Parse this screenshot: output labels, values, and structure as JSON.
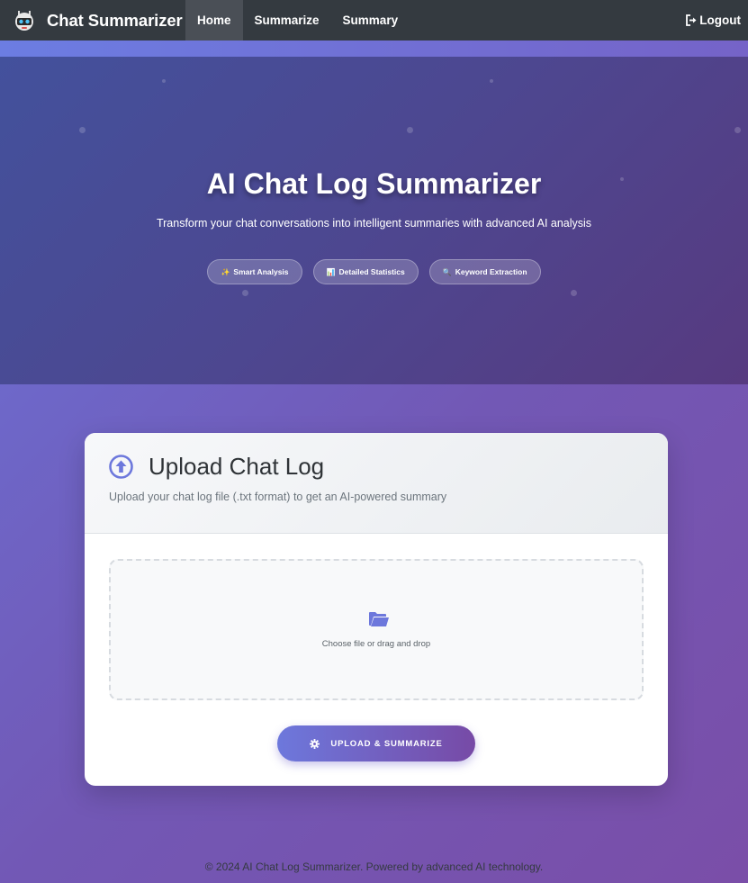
{
  "navbar": {
    "brand": "Chat Summarizer",
    "logo_icon": "robot-icon",
    "links": [
      {
        "label": "Home",
        "active": true
      },
      {
        "label": "Summarize",
        "active": false
      },
      {
        "label": "Summary",
        "active": false
      }
    ],
    "logout_label": "Logout",
    "logout_icon": "sign-out-icon"
  },
  "hero": {
    "title": "AI Chat Log Summarizer",
    "subtitle": "Transform your chat conversations into intelligent summaries with advanced AI analysis",
    "features": [
      {
        "icon": "sparkle-icon",
        "glyph": "✨",
        "label": "Smart Analysis"
      },
      {
        "icon": "bar-chart-icon",
        "glyph": "📊",
        "label": "Detailed Statistics"
      },
      {
        "icon": "magnifier-icon",
        "glyph": "🔍",
        "label": "Keyword Extraction"
      }
    ]
  },
  "upload_card": {
    "title": "Upload Chat Log",
    "title_icon": "arrow-up-circle-icon",
    "subtitle": "Upload your chat log file (.txt format) to get an AI-powered summary",
    "dropzone_icon": "folder-open-icon",
    "dropzone_text": "Choose file or drag and drop",
    "button_icon": "gear-icon",
    "button_label": "UPLOAD & SUMMARIZE"
  },
  "footer": {
    "text": "© 2024 AI Chat Log Summarizer. Powered by advanced AI technology."
  },
  "colors": {
    "navbar": "#343a40",
    "accent": "#6d78dc",
    "accent_end": "#774aa6",
    "hero_start": "#43519c",
    "hero_end": "#573a80"
  }
}
